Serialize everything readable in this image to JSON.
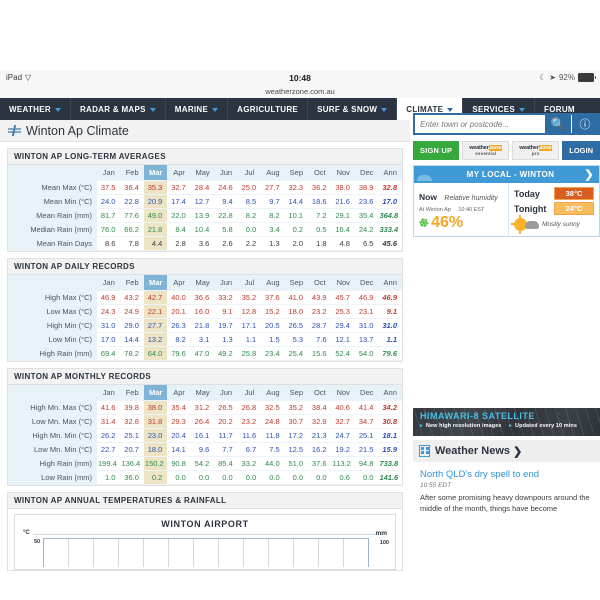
{
  "ios": {
    "device": "iPad",
    "wifi_icon": "wifi-icon",
    "time": "10:48",
    "battery_pct": "92%",
    "moon_icon": "moon-icon",
    "location_icon": "location-arrow-icon"
  },
  "browser": {
    "url": "weatherzone.com.au"
  },
  "nav": {
    "items": [
      {
        "label": "WEATHER",
        "has_chevron": true,
        "active": false
      },
      {
        "label": "RADAR & MAPS",
        "has_chevron": true,
        "active": false
      },
      {
        "label": "MARINE",
        "has_chevron": true,
        "active": false
      },
      {
        "label": "AGRICULTURE",
        "has_chevron": false,
        "active": false
      },
      {
        "label": "SURF & SNOW",
        "has_chevron": true,
        "active": false
      },
      {
        "label": "CLIMATE",
        "has_chevron": true,
        "active": true
      },
      {
        "label": "SERVICES",
        "has_chevron": true,
        "active": false
      },
      {
        "label": "FORUM",
        "has_chevron": false,
        "active": false
      }
    ]
  },
  "search": {
    "placeholder": "Enter town or postcode...",
    "value": "",
    "search_icon": "magnifier-icon",
    "info_icon": "info-circle-icon"
  },
  "account_bar": {
    "signup_label": "SIGN UP",
    "essential_brand": "weatherzone",
    "essential_sub": "essential",
    "pro_brand": "weatherzone",
    "pro_sub": "pro",
    "login_label": "LOGIN"
  },
  "local_widget": {
    "title": "MY LOCAL - WINTON",
    "arrow_icon": "chevron-right-icon",
    "now_label": "Now",
    "now_metric": "Relative humidity",
    "station": "At Winton Ap",
    "obs_time": "10:40 EST",
    "now_value": "46%",
    "humidity_icon": "humidity-leaf-icon",
    "today_label": "Today",
    "today_temp": "38°C",
    "tonight_label": "Tonight",
    "tonight_temp": "24°C",
    "condition": "Mostly sunny",
    "condition_icon": "sun-behind-cloud-icon"
  },
  "page": {
    "title": "Winton Ap Climate",
    "title_icon": "weather-station-icon"
  },
  "tables": [
    {
      "heading": "WINTON AP LONG-TERM AVERAGES",
      "columns": [
        "",
        "Jan",
        "Feb",
        "Mar",
        "Apr",
        "May",
        "Jun",
        "Jul",
        "Aug",
        "Sep",
        "Oct",
        "Nov",
        "Dec",
        "Ann"
      ],
      "highlight_column": "Mar",
      "rows": [
        {
          "label": "Mean Max (°C)",
          "color": "red",
          "values": [
            "37.5",
            "36.4",
            "35.3",
            "32.7",
            "28.4",
            "24.6",
            "25.0",
            "27.7",
            "32.3",
            "36.2",
            "38.0",
            "38.9",
            "32.8"
          ]
        },
        {
          "label": "Mean Min (°C)",
          "color": "blue",
          "values": [
            "24.0",
            "22.8",
            "20.9",
            "17.4",
            "12.7",
            "9.4",
            "8.5",
            "9.7",
            "14.4",
            "18.6",
            "21.6",
            "23.6",
            "17.0"
          ]
        },
        {
          "label": "Mean Rain (mm)",
          "color": "green",
          "values": [
            "81.7",
            "77.6",
            "49.0",
            "22.0",
            "13.9",
            "22.8",
            "8.2",
            "8.2",
            "10.1",
            "7.2",
            "29.1",
            "35.4",
            "364.8"
          ]
        },
        {
          "label": "Median Rain (mm)",
          "color": "green",
          "values": [
            "76.0",
            "66.2",
            "21.8",
            "8.4",
            "10.4",
            "5.8",
            "0.0",
            "3.4",
            "0.2",
            "0.5",
            "16.4",
            "24.2",
            "333.4"
          ]
        },
        {
          "label": "Mean Rain Days",
          "color": "gray",
          "values": [
            "8.6",
            "7.8",
            "4.4",
            "2.8",
            "3.6",
            "2.6",
            "2.2",
            "1.3",
            "2.0",
            "1.8",
            "4.8",
            "6.5",
            "45.6"
          ]
        }
      ]
    },
    {
      "heading": "WINTON AP DAILY RECORDS",
      "columns": [
        "",
        "Jan",
        "Feb",
        "Mar",
        "Apr",
        "May",
        "Jun",
        "Jul",
        "Aug",
        "Sep",
        "Oct",
        "Nov",
        "Dec",
        "Ann"
      ],
      "highlight_column": "Mar",
      "rows": [
        {
          "label": "High Max (°C)",
          "color": "red",
          "values": [
            "46.9",
            "43.2",
            "42.7",
            "40.0",
            "36.6",
            "33.2",
            "35.2",
            "37.6",
            "41.0",
            "43.9",
            "45.7",
            "46.9",
            "46.9"
          ]
        },
        {
          "label": "Low Max (°C)",
          "color": "red",
          "values": [
            "24.3",
            "24.9",
            "22.1",
            "20.1",
            "16.0",
            "9.1",
            "12.8",
            "15.2",
            "18.0",
            "23.2",
            "25.3",
            "23.1",
            "9.1"
          ]
        },
        {
          "label": "High Min (°C)",
          "color": "blue",
          "values": [
            "31.0",
            "29.0",
            "27.7",
            "26.3",
            "21.8",
            "19.7",
            "17.1",
            "20.5",
            "26.5",
            "28.7",
            "29.4",
            "31.0",
            "31.0"
          ]
        },
        {
          "label": "Low Min (°C)",
          "color": "blue",
          "values": [
            "17.0",
            "14.4",
            "13.2",
            "8.2",
            "3.1",
            "1.3",
            "1.1",
            "1.5",
            "5.3",
            "7.6",
            "12.1",
            "13.7",
            "1.1"
          ]
        },
        {
          "label": "High Rain (mm)",
          "color": "green",
          "values": [
            "69.4",
            "78.2",
            "64.0",
            "79.6",
            "47.0",
            "49.2",
            "25.8",
            "23.4",
            "25.4",
            "15.6",
            "52.4",
            "54.0",
            "79.6"
          ]
        }
      ]
    },
    {
      "heading": "WINTON AP MONTHLY RECORDS",
      "columns": [
        "",
        "Jan",
        "Feb",
        "Mar",
        "Apr",
        "May",
        "Jun",
        "Jul",
        "Aug",
        "Sep",
        "Oct",
        "Nov",
        "Dec",
        "Ann"
      ],
      "highlight_column": "Mar",
      "rows": [
        {
          "label": "High Mn. Max (°C)",
          "color": "red",
          "values": [
            "41.6",
            "39.8",
            "38.0",
            "35.4",
            "31.2",
            "26.5",
            "26.8",
            "32.5",
            "35.2",
            "38.4",
            "40.6",
            "41.4",
            "34.2"
          ]
        },
        {
          "label": "Low Mn. Max (°C)",
          "color": "red",
          "values": [
            "31.4",
            "32.8",
            "31.8",
            "29.3",
            "26.4",
            "20.2",
            "23.2",
            "24.8",
            "30.7",
            "32.9",
            "32.7",
            "34.7",
            "30.8"
          ]
        },
        {
          "label": "High Mn. Min (°C)",
          "color": "blue",
          "values": [
            "26.2",
            "25.1",
            "23.0",
            "20.4",
            "16.1",
            "11.7",
            "11.6",
            "11.8",
            "17.2",
            "21.3",
            "24.7",
            "25.1",
            "18.1"
          ]
        },
        {
          "label": "Low Mn. Min (°C)",
          "color": "blue",
          "values": [
            "22.7",
            "20.7",
            "18.0",
            "14.1",
            "9.6",
            "7.7",
            "6.7",
            "7.5",
            "12.5",
            "16.2",
            "19.2",
            "21.5",
            "15.9"
          ]
        },
        {
          "label": "High Rain (mm)",
          "color": "green",
          "values": [
            "199.4",
            "136.4",
            "150.2",
            "90.8",
            "54.2",
            "85.4",
            "33.2",
            "44.0",
            "51.0",
            "37.6",
            "113.2",
            "94.8",
            "733.8"
          ]
        },
        {
          "label": "Low Rain (mm)",
          "color": "green",
          "values": [
            "1.0",
            "36.0",
            "0.2",
            "0.0",
            "0.0",
            "0.0",
            "0.0",
            "0.0",
            "0.0",
            "0.0",
            "0.6",
            "0.0",
            "141.6"
          ]
        }
      ]
    }
  ],
  "chart_section": {
    "heading": "WINTON AP ANNUAL TEMPERATURES & RAINFALL"
  },
  "chart_data": {
    "type": "line",
    "title": "WINTON AIRPORT",
    "ylabel": "°C",
    "y2label": "mm",
    "ytick_top": "50",
    "y2tick_top": "100",
    "grid": true,
    "series": [],
    "x": [],
    "note": "Chart plot area is blank/unloaded in the screenshot; only axes, title and top tick labels are rendered."
  },
  "himawari": {
    "title": "HIMAWARI-8 SATELLITE",
    "bullet1": "New high resolution images",
    "bullet2": "Updated every 10 mins"
  },
  "news": {
    "title": "Weather News",
    "arrow_icon": "chevron-right-icon",
    "icon": "newspaper-icon",
    "headline": "North QLD's dry spell to end",
    "time": "10:55 EDT",
    "excerpt": "After some promising heavy downpours around the middle of the month, things have become"
  },
  "colors": {
    "nav_bg": "#2b3440",
    "accent_blue": "#2e6da4",
    "light_blue": "#3f9ad6",
    "green": "#37a93c",
    "highlight_cell": "#ece4c4",
    "highlight_header": "#7fb4d6",
    "col_header": "#e6f1f8"
  }
}
